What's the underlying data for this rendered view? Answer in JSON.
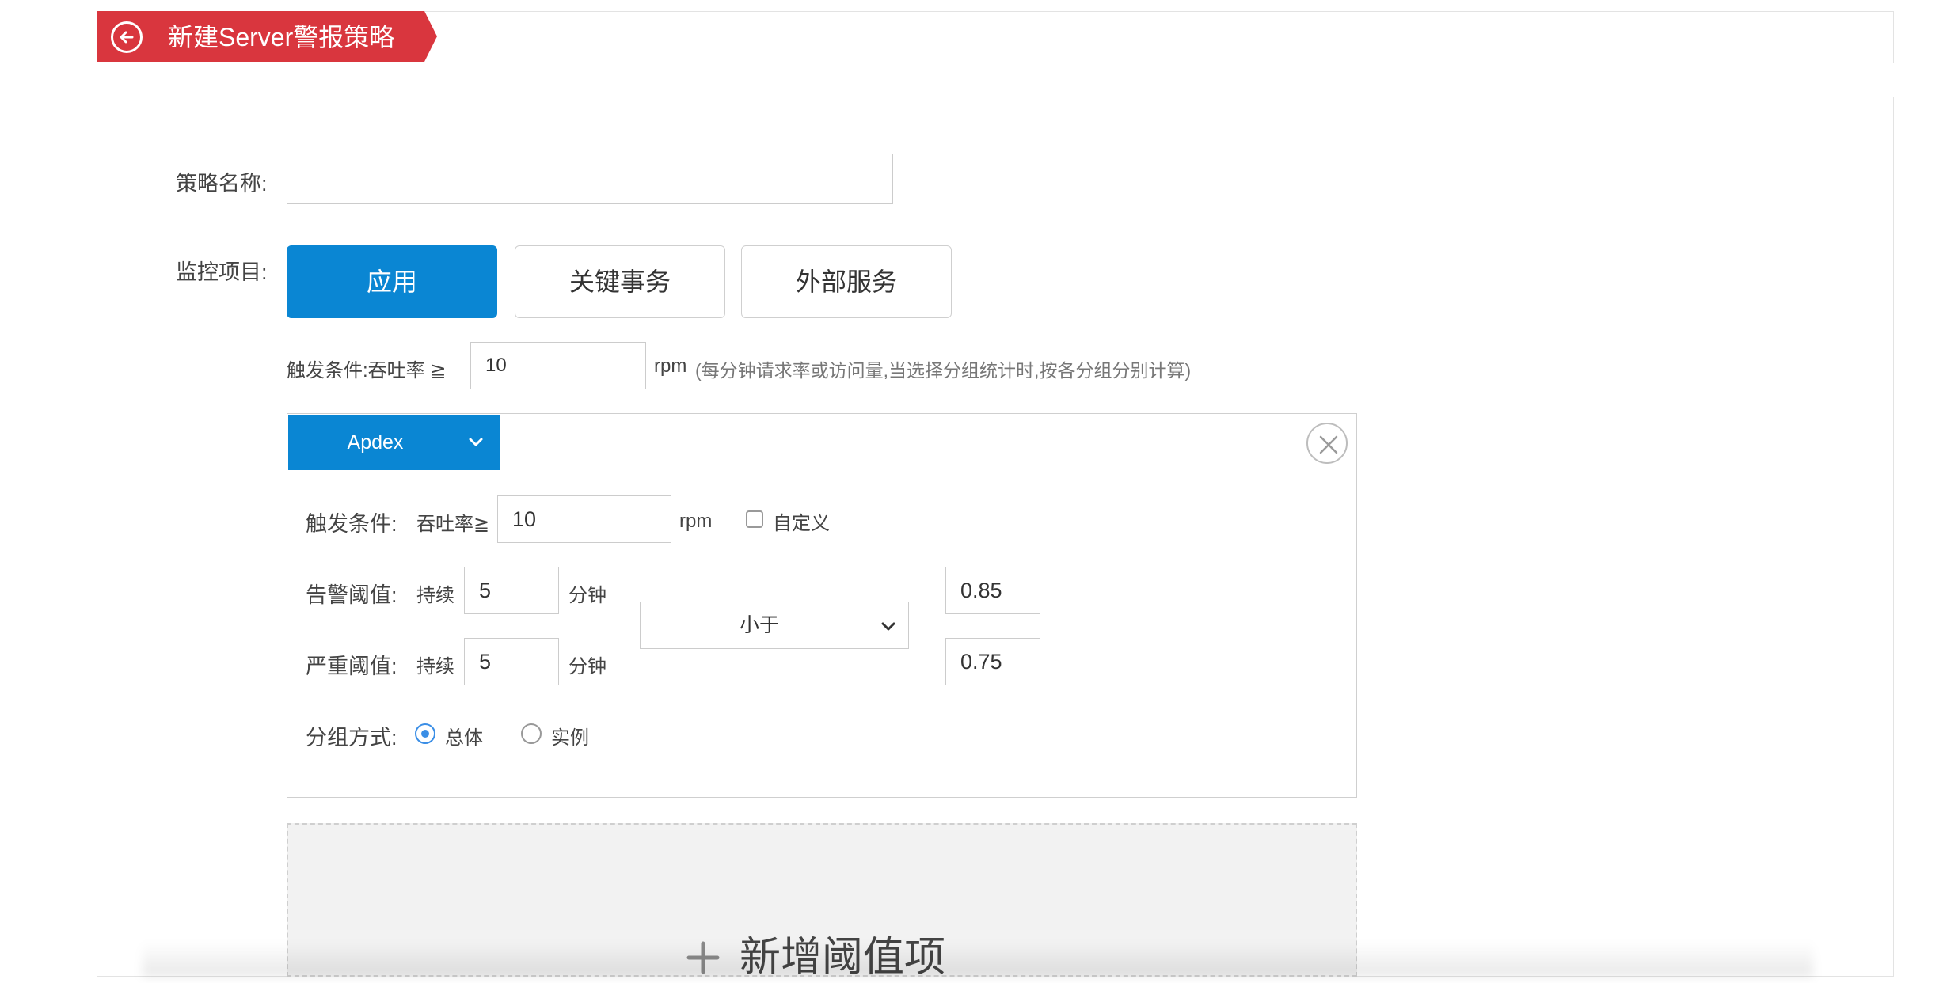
{
  "header": {
    "title": "新建Server警报策略",
    "back_icon": "arrow-left-circle-icon",
    "accent_color": "#d9363e"
  },
  "form": {
    "policy_name_label": "策略名称:",
    "policy_name_value": "",
    "monitor_label": "监控项目:",
    "monitor_options": [
      "应用",
      "关键事务",
      "外部服务"
    ],
    "monitor_selected": "应用",
    "trigger": {
      "label": "触发条件:吞吐率 ≧",
      "value": "10",
      "unit": "rpm",
      "hint": "(每分钟请求率或访问量,当选择分组统计时,按各分组分别计算)"
    }
  },
  "rule": {
    "type": "Apdex",
    "close_icon": "close-circle-icon",
    "trigger_label": "触发条件:",
    "trigger_sub_label": "吞吐率≧",
    "trigger_value": "10",
    "trigger_unit": "rpm",
    "custom_label": "自定义",
    "custom_checked": false,
    "warning": {
      "label": "告警阈值:",
      "duration_label": "持续",
      "duration_value": "5",
      "duration_unit": "分钟",
      "threshold": "0.85"
    },
    "critical": {
      "label": "严重阈值:",
      "duration_label": "持续",
      "duration_value": "5",
      "duration_unit": "分钟",
      "threshold": "0.75"
    },
    "comparator": "小于",
    "group": {
      "label": "分组方式:",
      "options": [
        "总体",
        "实例"
      ],
      "selected": "总体"
    }
  },
  "add_threshold_label": "新增阈值项",
  "colors": {
    "primary": "#0a86d3",
    "radio_checked": "#3a8ee6"
  }
}
